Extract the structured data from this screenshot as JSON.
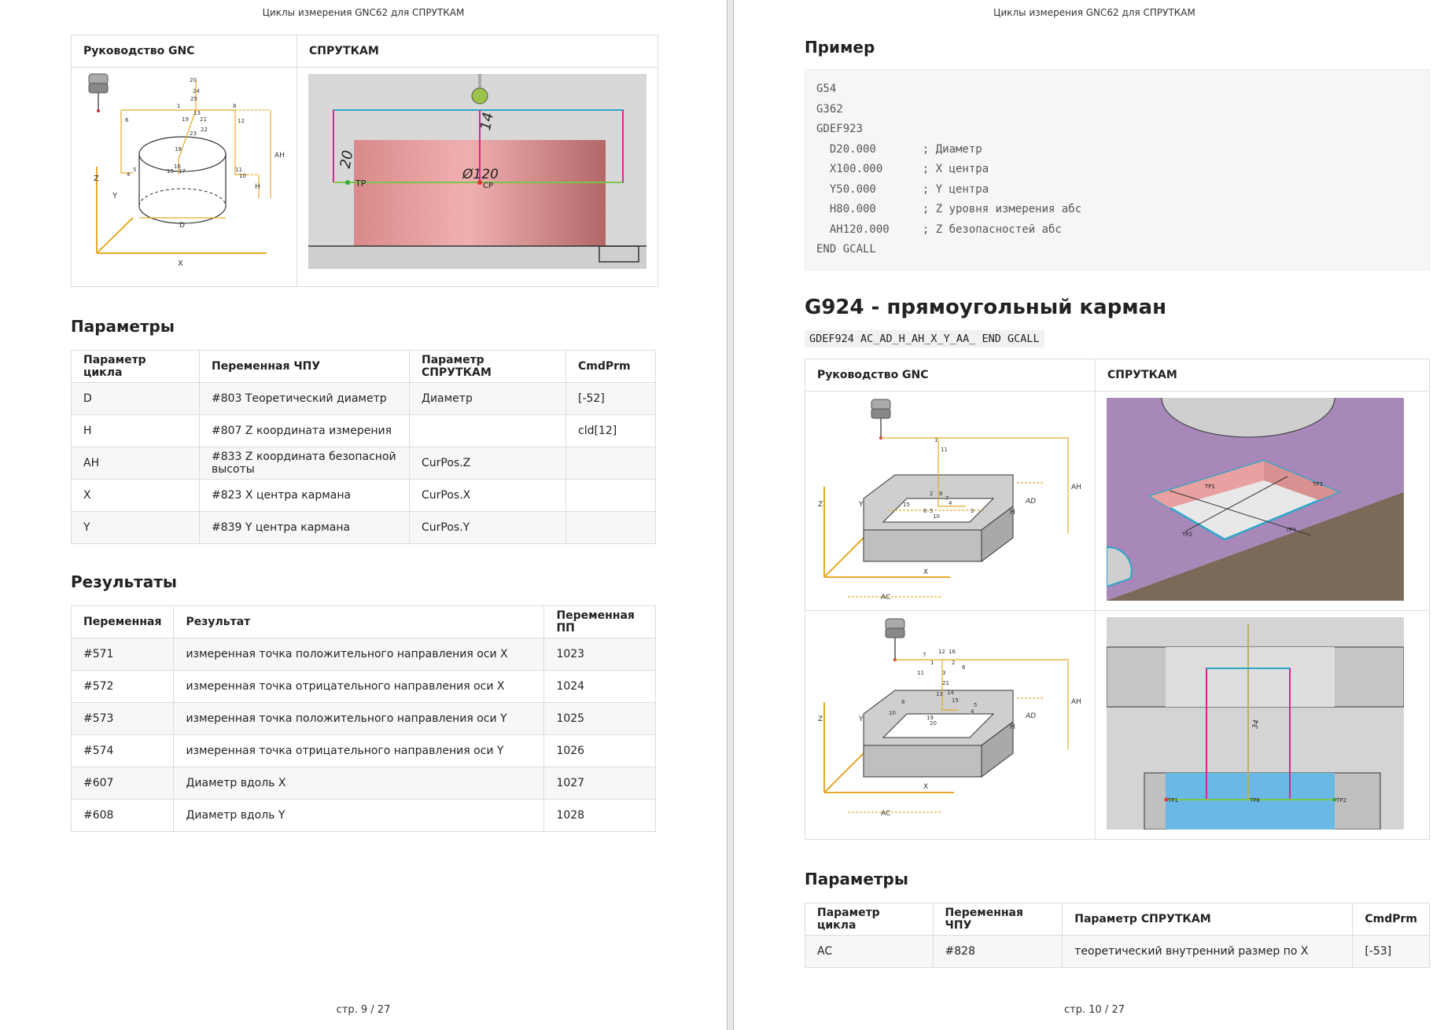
{
  "left_page": {
    "running_header": "Циклы измерения GNC62 для СПРУТКАМ",
    "footer": "стр. 9 / 27",
    "image_table": {
      "col1": "Руководство GNC",
      "col2": "СПРУТКАМ",
      "sprut_labels": {
        "dim_14": "14",
        "dim_20": "20",
        "dia": "Ø120",
        "tp": "TP",
        "cp": "CP"
      },
      "gnc_labels": [
        "20",
        "24",
        "25",
        "1",
        "13",
        "19",
        "21",
        "23",
        "22",
        "8",
        "12",
        "6",
        "18",
        "4",
        "5",
        "15",
        "16",
        "17",
        "11",
        "10",
        "AH",
        "H",
        "D",
        "X",
        "Y",
        "Z"
      ]
    },
    "params_title": "Параметры",
    "params_table": {
      "headers": [
        "Параметр цикла",
        "Переменная ЧПУ",
        "Параметр СПРУТКАМ",
        "CmdPrm"
      ],
      "rows": [
        [
          "D",
          "#803 Теоретический диаметр",
          "Диаметр",
          "[-52]"
        ],
        [
          "H",
          "#807 Z координата измерения",
          "",
          "cld[12]"
        ],
        [
          "AH",
          "#833 Z координата безопасной высоты",
          "CurPos.Z",
          ""
        ],
        [
          "X",
          "#823 X центра кармана",
          "CurPos.X",
          ""
        ],
        [
          "Y",
          "#839 Y центра кармана",
          "CurPos.Y",
          ""
        ]
      ]
    },
    "results_title": "Результаты",
    "results_table": {
      "headers": [
        "Переменная",
        "Результат",
        "Переменная ПП"
      ],
      "rows": [
        [
          "#571",
          "измеренная точка положительного направления оси X",
          "1023"
        ],
        [
          "#572",
          "измеренная точка отрицательного направления оси X",
          "1024"
        ],
        [
          "#573",
          "измеренная точка положительного направления оси Y",
          "1025"
        ],
        [
          "#574",
          "измеренная точка отрицательного направления оси Y",
          "1026"
        ],
        [
          "#607",
          "Диаметр вдоль X",
          "1027"
        ],
        [
          "#608",
          "Диаметр вдоль Y",
          "1028"
        ]
      ]
    }
  },
  "right_page": {
    "running_header": "Циклы измерения GNC62 для СПРУТКАМ",
    "footer": "стр. 10 / 27",
    "example_title": "Пример",
    "code": "G54\nG362\nGDEF923\n  D20.000       ; Диаметр\n  X100.000      ; X центра\n  Y50.000       ; Y центра\n  H80.000       ; Z уровня измерения абс\n  AH120.000     ; Z безопасностей абс\nEND GCALL",
    "g924_title": "G924 - прямоугольный карман",
    "g924_code": "GDEF924 AC_AD_H_AH_X_Y_AA_ END GCALL",
    "image_table": {
      "col1": "Руководство GNC",
      "col2": "СПРУТКАМ",
      "gnc1_labels": [
        "1",
        "11",
        "AH",
        "AD",
        "H",
        "Z",
        "Y",
        "X",
        "AC",
        "2",
        "8",
        "7",
        "4",
        "6",
        "5",
        "10",
        "3",
        "15"
      ],
      "sprut1_labels": [
        "TP1",
        "TP2",
        "TP3",
        "TP4",
        "TP5",
        "TP6",
        "TP7"
      ],
      "gnc2_labels": [
        "7",
        "12",
        "16",
        "1",
        "2",
        "6",
        "11",
        "3",
        "21",
        "13",
        "14",
        "15",
        "8",
        "4",
        "5",
        "10",
        "19",
        "20",
        "AH",
        "AD",
        "H",
        "Z",
        "Y",
        "X",
        "AC"
      ],
      "sprut2_labels": [
        "TP1",
        "TP2",
        "TP8",
        "34"
      ]
    },
    "params_title": "Параметры",
    "params_table": {
      "headers": [
        "Параметр цикла",
        "Переменная ЧПУ",
        "Параметр СПРУТКАМ",
        "CmdPrm"
      ],
      "rows": [
        [
          "AC",
          "#828",
          "теоретический внутренний размер по X",
          "[-53]"
        ]
      ]
    }
  }
}
